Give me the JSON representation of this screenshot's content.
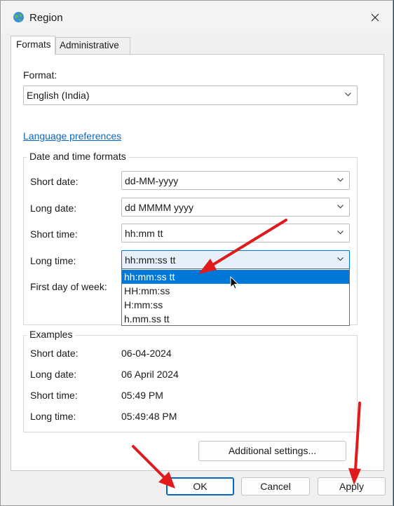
{
  "window": {
    "title": "Region",
    "close_label": "✕"
  },
  "tabs": [
    {
      "label": "Formats"
    },
    {
      "label": "Administrative"
    }
  ],
  "format": {
    "label": "Format:",
    "value": "English (India)"
  },
  "language_link": "Language preferences",
  "date_time_formats": {
    "title": "Date and time formats",
    "short_date": {
      "label": "Short date:",
      "value": "dd-MM-yyyy"
    },
    "long_date": {
      "label": "Long date:",
      "value": "dd MMMM yyyy"
    },
    "short_time": {
      "label": "Short time:",
      "value": "hh:mm tt"
    },
    "long_time": {
      "label": "Long time:",
      "value": "hh:mm:ss tt"
    },
    "first_day": {
      "label": "First day of week:"
    },
    "long_time_options": [
      "hh:mm:ss tt",
      "HH:mm:ss",
      "H:mm:ss",
      "h.mm.ss tt"
    ]
  },
  "examples": {
    "title": "Examples",
    "short_date": {
      "label": "Short date:",
      "value": "06-04-2024"
    },
    "long_date": {
      "label": "Long date:",
      "value": "06 April 2024"
    },
    "short_time": {
      "label": "Short time:",
      "value": "05:49 PM"
    },
    "long_time": {
      "label": "Long time:",
      "value": "05:49:48 PM"
    }
  },
  "buttons": {
    "additional_settings": "Additional settings...",
    "ok": "OK",
    "cancel": "Cancel",
    "apply": "Apply"
  },
  "colors": {
    "accent": "#0078d7",
    "arrow": "#e01b1b",
    "link": "#0b67c2"
  }
}
